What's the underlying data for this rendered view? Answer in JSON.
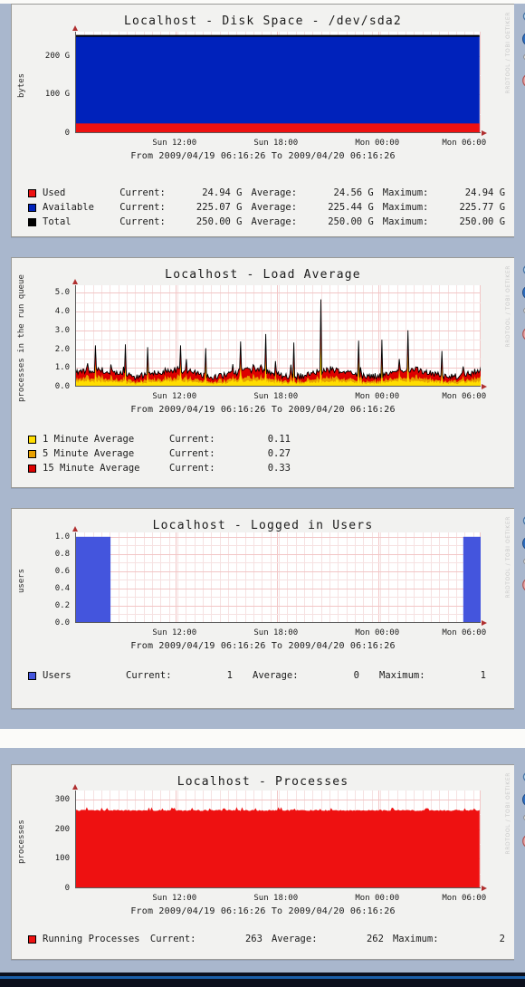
{
  "theme": {
    "page_bg": "#a9b7cd",
    "panel_bg": "#f2f2f0",
    "grid_color": "#f2c6c6",
    "axis_color": "#5a5a5a"
  },
  "watermark": "RRDTOOL / TOBI OETIKER",
  "toolbar_icons": [
    {
      "name": "zoom-icon",
      "label": "Zoom Graph"
    },
    {
      "name": "download-icon",
      "label": "Download Graph"
    },
    {
      "name": "properties-icon",
      "label": "Graph Properties"
    },
    {
      "name": "page-icon",
      "label": "Graph Source/Page"
    }
  ],
  "panels": [
    {
      "title": "Localhost - Disk Space - /dev/sda2",
      "timespan": "From 2009/04/19 06:16:26 To 2009/04/20 06:16:26",
      "legend_headers": [
        "Current:",
        "Average:",
        "Maximum:"
      ],
      "legend": [
        {
          "color": "#ee1111",
          "name": "Used",
          "current": "24.94 G",
          "average": "24.56 G",
          "maximum": "24.94 G"
        },
        {
          "color": "#0022bb",
          "name": "Available",
          "current": "225.07 G",
          "average": "225.44 G",
          "maximum": "225.77 G"
        },
        {
          "color": "#000000",
          "name": "Total",
          "current": "250.00 G",
          "average": "250.00 G",
          "maximum": "250.00 G"
        }
      ],
      "chart_data": {
        "type": "area",
        "title": "Localhost - Disk Space - /dev/sda2",
        "xlabel": "",
        "ylabel": "bytes",
        "yticks": [
          "0",
          "100 G",
          "200 G"
        ],
        "ytick_values": [
          0,
          100,
          200
        ],
        "ylim": [
          0,
          262
        ],
        "xticks": [
          "Sun 12:00",
          "Sun 18:00",
          "Mon 00:00",
          "Mon 06:00"
        ],
        "xtick_positions": [
          0.245,
          0.495,
          0.745,
          0.995
        ],
        "grid": true,
        "legend_position": "below",
        "stacked": true,
        "series": [
          {
            "name": "Used",
            "color": "#ee1111",
            "constant_value": 24.94,
            "unit": "G"
          },
          {
            "name": "Available",
            "color": "#0022bb",
            "constant_value": 225.07,
            "unit": "G"
          },
          {
            "name": "Total",
            "color": "#000000",
            "constant_value": 250.0,
            "unit": "G"
          }
        ]
      }
    },
    {
      "title": "Localhost - Load Average",
      "timespan": "From 2009/04/19 06:16:26 To 2009/04/20 06:16:26",
      "legend_headers": [
        "Current:"
      ],
      "legend": [
        {
          "color": "#ffdd00",
          "name": "1 Minute Average",
          "current": "0.11"
        },
        {
          "color": "#e8a000",
          "name": "5 Minute Average",
          "current": "0.27"
        },
        {
          "color": "#dd0000",
          "name": "15 Minute Average",
          "current": "0.33"
        }
      ],
      "chart_data": {
        "type": "area",
        "title": "Localhost - Load Average",
        "xlabel": "",
        "ylabel": "processes in the run queue",
        "yticks": [
          "0.0",
          "1.0",
          "2.0",
          "3.0",
          "4.0",
          "5.0"
        ],
        "ytick_values": [
          0,
          1,
          2,
          3,
          4,
          5
        ],
        "ylim": [
          0,
          5.4
        ],
        "xticks": [
          "Sun 12:00",
          "Sun 18:00",
          "Mon 00:00",
          "Mon 06:00"
        ],
        "xtick_positions": [
          0.245,
          0.495,
          0.745,
          0.995
        ],
        "grid": true,
        "legend_position": "below",
        "stacked": true,
        "series": [
          {
            "name": "1 Minute Average",
            "color": "#ffdd00",
            "typical": 0.35,
            "current": 0.11
          },
          {
            "name": "5 Minute Average",
            "color": "#e8a000",
            "typical": 0.55,
            "current": 0.27
          },
          {
            "name": "15 Minute Average",
            "color": "#dd0000",
            "typical": 0.85,
            "current": 0.33
          }
        ],
        "notable_peaks": [
          2.2,
          2.25,
          2.1,
          2.2,
          2.05,
          2.4,
          2.8,
          2.35,
          4.65,
          2.45,
          2.5,
          3.0,
          1.9
        ]
      }
    },
    {
      "title": "Localhost - Logged in Users",
      "timespan": "From 2009/04/19 06:16:26 To 2009/04/20 06:16:26",
      "legend_headers": [
        "Current:",
        "Average:",
        "Maximum:"
      ],
      "legend": [
        {
          "color": "#4455dd",
          "name": "Users",
          "current": "1",
          "average": "0",
          "maximum": "1"
        }
      ],
      "chart_data": {
        "type": "area",
        "title": "Localhost - Logged in Users",
        "xlabel": "",
        "ylabel": "users",
        "yticks": [
          "0.0",
          "0.2",
          "0.4",
          "0.6",
          "0.8",
          "1.0"
        ],
        "ytick_values": [
          0,
          0.2,
          0.4,
          0.6,
          0.8,
          1.0
        ],
        "ylim": [
          0,
          1.05
        ],
        "xticks": [
          "Sun 12:00",
          "Sun 18:00",
          "Mon 00:00",
          "Mon 06:00"
        ],
        "xtick_positions": [
          0.245,
          0.495,
          0.745,
          0.995
        ],
        "grid": true,
        "legend_position": "below",
        "series": [
          {
            "name": "Users",
            "color": "#4455dd",
            "blocks": [
              {
                "start": 0.0,
                "end": 0.085,
                "value": 1
              },
              {
                "start": 0.955,
                "end": 1.0,
                "value": 1
              }
            ],
            "baseline": 0
          }
        ]
      }
    },
    {
      "title": "Localhost - Processes",
      "timespan": "From 2009/04/19 06:16:26 To 2009/04/20 06:16:26",
      "legend_headers": [
        "Current:",
        "Average:",
        "Maximum:"
      ],
      "legend": [
        {
          "color": "#ee1111",
          "name": "Running Processes",
          "current": "263",
          "average": "262",
          "maximum": "2"
        }
      ],
      "chart_data": {
        "type": "area",
        "title": "Localhost - Processes",
        "xlabel": "",
        "ylabel": "processes",
        "yticks": [
          "0",
          "100",
          "200",
          "300"
        ],
        "ytick_values": [
          0,
          100,
          200,
          300
        ],
        "ylim": [
          0,
          330
        ],
        "xticks": [
          "Sun 12:00",
          "Sun 18:00",
          "Mon 00:00",
          "Mon 06:00"
        ],
        "xtick_positions": [
          0.245,
          0.495,
          0.745,
          0.995
        ],
        "grid": true,
        "legend_position": "below",
        "series": [
          {
            "name": "Running Processes",
            "color": "#ee1111",
            "typical": 262,
            "current": 263,
            "peak": 272
          }
        ]
      }
    }
  ]
}
